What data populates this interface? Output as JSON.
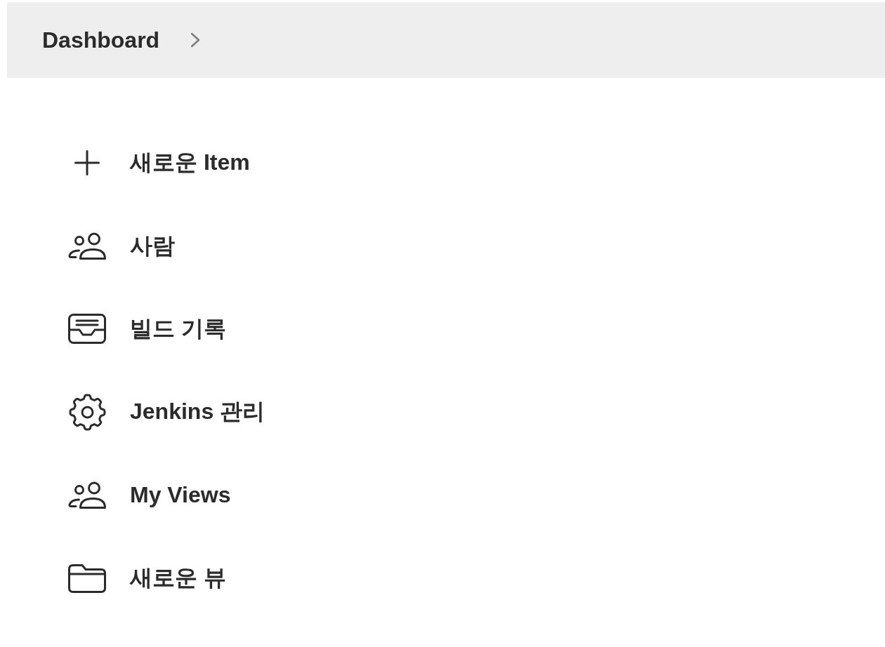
{
  "breadcrumb": {
    "items": [
      {
        "label": "Dashboard"
      }
    ]
  },
  "tasks": [
    {
      "kind": "create",
      "label": "새로운 Item"
    },
    {
      "kind": "people",
      "label": "사람"
    },
    {
      "kind": "history",
      "label": "빌드 기록"
    },
    {
      "kind": "manage",
      "label": "Jenkins 관리"
    },
    {
      "kind": "views",
      "label": "My Views"
    },
    {
      "kind": "newview",
      "label": "새로운 뷰"
    }
  ]
}
